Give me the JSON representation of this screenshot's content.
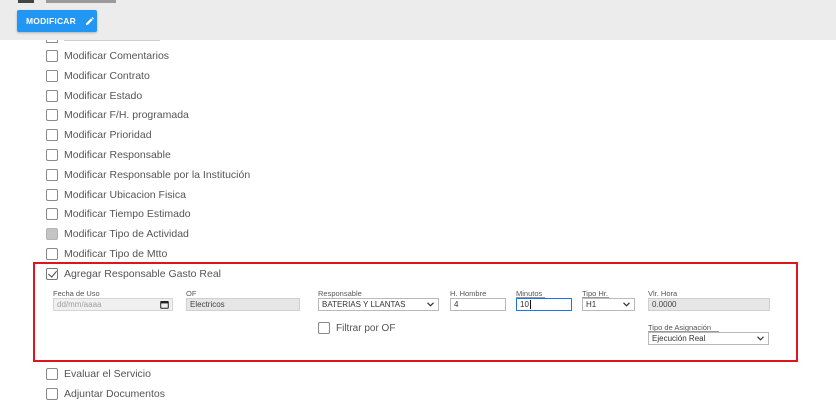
{
  "toolbar": {
    "modify_label": "MODIFICAR"
  },
  "options": [
    {
      "label": "Modificar Comentarios",
      "checked": false,
      "disabled": false
    },
    {
      "label": "Modificar Contrato",
      "checked": false,
      "disabled": false
    },
    {
      "label": "Modificar Estado",
      "checked": false,
      "disabled": false
    },
    {
      "label": "Modificar F/H. programada",
      "checked": false,
      "disabled": false
    },
    {
      "label": "Modificar Prioridad",
      "checked": false,
      "disabled": false
    },
    {
      "label": "Modificar Responsable",
      "checked": false,
      "disabled": false
    },
    {
      "label": "Modificar Responsable por la Institución",
      "checked": false,
      "disabled": false
    },
    {
      "label": "Modificar Ubicacion Fisica",
      "checked": false,
      "disabled": false
    },
    {
      "label": "Modificar Tiempo Estimado",
      "checked": false,
      "disabled": false
    },
    {
      "label": "Modificar Tipo de Actividad",
      "checked": false,
      "disabled": true
    },
    {
      "label": "Modificar Tipo de Mtto",
      "checked": false,
      "disabled": false
    }
  ],
  "expense": {
    "label": "Agregar Responsable Gasto Real",
    "checked": true,
    "fields": {
      "fecha_label": "Fecha de Uso",
      "fecha_placeholder": "dd/mm/aaaa",
      "of_label": "OF",
      "of_value": "Electricos",
      "responsable_label": "Responsable",
      "responsable_value": "BATERIAS Y LLANTAS",
      "hhombre_label": "H. Hombre",
      "hhombre_value": "4",
      "minutos_label": "Minutos",
      "minutos_value": "10",
      "tipohr_label": "Tipo Hr.",
      "tipohr_value": "H1",
      "vlrhora_label": "Vlr. Hora",
      "vlrhora_value": "0.0000",
      "filtrar_label": "Filtrar por OF",
      "asignacion_label": "Tipo de Asignación",
      "asignacion_value": "Ejecución Real"
    }
  },
  "bottom_options": [
    {
      "label": "Evaluar el Servicio",
      "checked": false
    },
    {
      "label": "Adjuntar Documentos",
      "checked": false
    }
  ],
  "colors": {
    "primary": "#2196f3",
    "highlight": "#e0141c",
    "toolbar_bg": "#ececec"
  }
}
